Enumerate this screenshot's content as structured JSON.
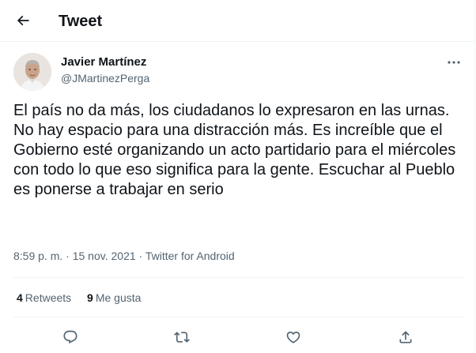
{
  "header": {
    "back_icon": "arrow-left-icon",
    "title": "Tweet"
  },
  "author": {
    "name": "Javier Martínez",
    "handle": "@JMartinezPerga",
    "avatar_icon": "profile-photo"
  },
  "tweet": {
    "text": "El país no da más, los ciudadanos lo expresaron en las urnas. No hay espacio para una distracción más. Es increíble que el Gobierno esté organizando un acto partidario para el miércoles con todo lo que eso significa para la gente. Escuchar al Pueblo es ponerse a trabajar en serio",
    "time": "8:59 p. m.",
    "separator": "·",
    "date": "15 nov. 2021",
    "source": "Twitter for Android"
  },
  "stats": {
    "retweets_count": "4",
    "retweets_label": "Retweets",
    "likes_count": "9",
    "likes_label": "Me gusta"
  },
  "actions": [
    "reply-icon",
    "retweet-icon",
    "like-icon",
    "share-icon"
  ],
  "colors": {
    "text_primary": "#0f1419",
    "text_secondary": "#536471",
    "divider": "#eff3f4"
  }
}
